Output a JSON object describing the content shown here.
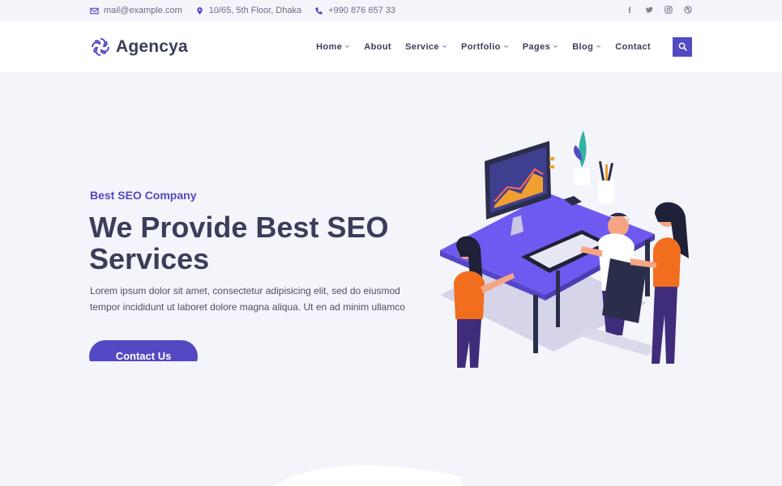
{
  "topbar": {
    "email": "mail@example.com",
    "address": "10/65, 5th Floor, Dhaka",
    "phone": "+990 876 657 33",
    "social": [
      "facebook-icon",
      "twitter-icon",
      "instagram-icon",
      "dribbble-icon"
    ]
  },
  "brand": {
    "name": "Agencya",
    "accent": "#5349c2",
    "dark": "#3b3e5a"
  },
  "nav": {
    "items": [
      {
        "label": "Home",
        "dropdown": true
      },
      {
        "label": "About",
        "dropdown": false
      },
      {
        "label": "Service",
        "dropdown": true
      },
      {
        "label": "Portfolio",
        "dropdown": true
      },
      {
        "label": "Pages",
        "dropdown": true
      },
      {
        "label": "Blog",
        "dropdown": true
      },
      {
        "label": "Contact",
        "dropdown": false
      }
    ],
    "search_icon": "search-icon"
  },
  "hero": {
    "eyebrow": "Best SEO Company",
    "headline_line1": "We Provide Best SEO",
    "headline_line2": "Services",
    "description": "Lorem ipsum dolor sit amet, consectetur adipisicing elit, sed do eiusmod tempor incididunt ut laboret dolore magna aliqua. Ut en ad minim ullamco",
    "cta_label": "Contact Us"
  }
}
